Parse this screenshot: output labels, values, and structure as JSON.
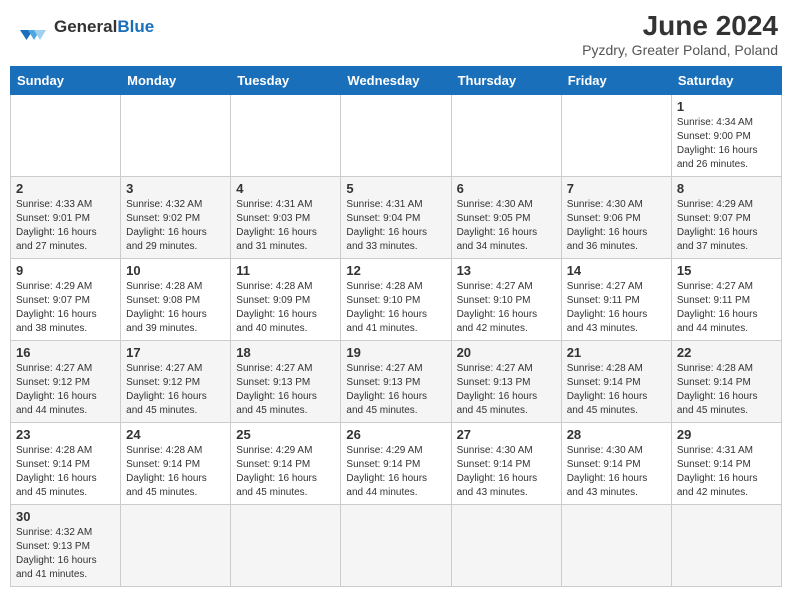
{
  "header": {
    "logo_text_general": "General",
    "logo_text_blue": "Blue",
    "title": "June 2024",
    "subtitle": "Pyzdry, Greater Poland, Poland"
  },
  "days_of_week": [
    "Sunday",
    "Monday",
    "Tuesday",
    "Wednesday",
    "Thursday",
    "Friday",
    "Saturday"
  ],
  "weeks": [
    [
      {
        "day": "",
        "info": ""
      },
      {
        "day": "",
        "info": ""
      },
      {
        "day": "",
        "info": ""
      },
      {
        "day": "",
        "info": ""
      },
      {
        "day": "",
        "info": ""
      },
      {
        "day": "",
        "info": ""
      },
      {
        "day": "1",
        "info": "Sunrise: 4:34 AM\nSunset: 9:00 PM\nDaylight: 16 hours\nand 26 minutes."
      }
    ],
    [
      {
        "day": "2",
        "info": "Sunrise: 4:33 AM\nSunset: 9:01 PM\nDaylight: 16 hours\nand 27 minutes."
      },
      {
        "day": "3",
        "info": "Sunrise: 4:32 AM\nSunset: 9:02 PM\nDaylight: 16 hours\nand 29 minutes."
      },
      {
        "day": "4",
        "info": "Sunrise: 4:31 AM\nSunset: 9:03 PM\nDaylight: 16 hours\nand 31 minutes."
      },
      {
        "day": "5",
        "info": "Sunrise: 4:31 AM\nSunset: 9:04 PM\nDaylight: 16 hours\nand 33 minutes."
      },
      {
        "day": "6",
        "info": "Sunrise: 4:30 AM\nSunset: 9:05 PM\nDaylight: 16 hours\nand 34 minutes."
      },
      {
        "day": "7",
        "info": "Sunrise: 4:30 AM\nSunset: 9:06 PM\nDaylight: 16 hours\nand 36 minutes."
      },
      {
        "day": "8",
        "info": "Sunrise: 4:29 AM\nSunset: 9:07 PM\nDaylight: 16 hours\nand 37 minutes."
      }
    ],
    [
      {
        "day": "9",
        "info": "Sunrise: 4:29 AM\nSunset: 9:07 PM\nDaylight: 16 hours\nand 38 minutes."
      },
      {
        "day": "10",
        "info": "Sunrise: 4:28 AM\nSunset: 9:08 PM\nDaylight: 16 hours\nand 39 minutes."
      },
      {
        "day": "11",
        "info": "Sunrise: 4:28 AM\nSunset: 9:09 PM\nDaylight: 16 hours\nand 40 minutes."
      },
      {
        "day": "12",
        "info": "Sunrise: 4:28 AM\nSunset: 9:10 PM\nDaylight: 16 hours\nand 41 minutes."
      },
      {
        "day": "13",
        "info": "Sunrise: 4:27 AM\nSunset: 9:10 PM\nDaylight: 16 hours\nand 42 minutes."
      },
      {
        "day": "14",
        "info": "Sunrise: 4:27 AM\nSunset: 9:11 PM\nDaylight: 16 hours\nand 43 minutes."
      },
      {
        "day": "15",
        "info": "Sunrise: 4:27 AM\nSunset: 9:11 PM\nDaylight: 16 hours\nand 44 minutes."
      }
    ],
    [
      {
        "day": "16",
        "info": "Sunrise: 4:27 AM\nSunset: 9:12 PM\nDaylight: 16 hours\nand 44 minutes."
      },
      {
        "day": "17",
        "info": "Sunrise: 4:27 AM\nSunset: 9:12 PM\nDaylight: 16 hours\nand 45 minutes."
      },
      {
        "day": "18",
        "info": "Sunrise: 4:27 AM\nSunset: 9:13 PM\nDaylight: 16 hours\nand 45 minutes."
      },
      {
        "day": "19",
        "info": "Sunrise: 4:27 AM\nSunset: 9:13 PM\nDaylight: 16 hours\nand 45 minutes."
      },
      {
        "day": "20",
        "info": "Sunrise: 4:27 AM\nSunset: 9:13 PM\nDaylight: 16 hours\nand 45 minutes."
      },
      {
        "day": "21",
        "info": "Sunrise: 4:28 AM\nSunset: 9:14 PM\nDaylight: 16 hours\nand 45 minutes."
      },
      {
        "day": "22",
        "info": "Sunrise: 4:28 AM\nSunset: 9:14 PM\nDaylight: 16 hours\nand 45 minutes."
      }
    ],
    [
      {
        "day": "23",
        "info": "Sunrise: 4:28 AM\nSunset: 9:14 PM\nDaylight: 16 hours\nand 45 minutes."
      },
      {
        "day": "24",
        "info": "Sunrise: 4:28 AM\nSunset: 9:14 PM\nDaylight: 16 hours\nand 45 minutes."
      },
      {
        "day": "25",
        "info": "Sunrise: 4:29 AM\nSunset: 9:14 PM\nDaylight: 16 hours\nand 45 minutes."
      },
      {
        "day": "26",
        "info": "Sunrise: 4:29 AM\nSunset: 9:14 PM\nDaylight: 16 hours\nand 44 minutes."
      },
      {
        "day": "27",
        "info": "Sunrise: 4:30 AM\nSunset: 9:14 PM\nDaylight: 16 hours\nand 43 minutes."
      },
      {
        "day": "28",
        "info": "Sunrise: 4:30 AM\nSunset: 9:14 PM\nDaylight: 16 hours\nand 43 minutes."
      },
      {
        "day": "29",
        "info": "Sunrise: 4:31 AM\nSunset: 9:14 PM\nDaylight: 16 hours\nand 42 minutes."
      }
    ],
    [
      {
        "day": "30",
        "info": "Sunrise: 4:32 AM\nSunset: 9:13 PM\nDaylight: 16 hours\nand 41 minutes."
      },
      {
        "day": "",
        "info": ""
      },
      {
        "day": "",
        "info": ""
      },
      {
        "day": "",
        "info": ""
      },
      {
        "day": "",
        "info": ""
      },
      {
        "day": "",
        "info": ""
      },
      {
        "day": "",
        "info": ""
      }
    ]
  ]
}
